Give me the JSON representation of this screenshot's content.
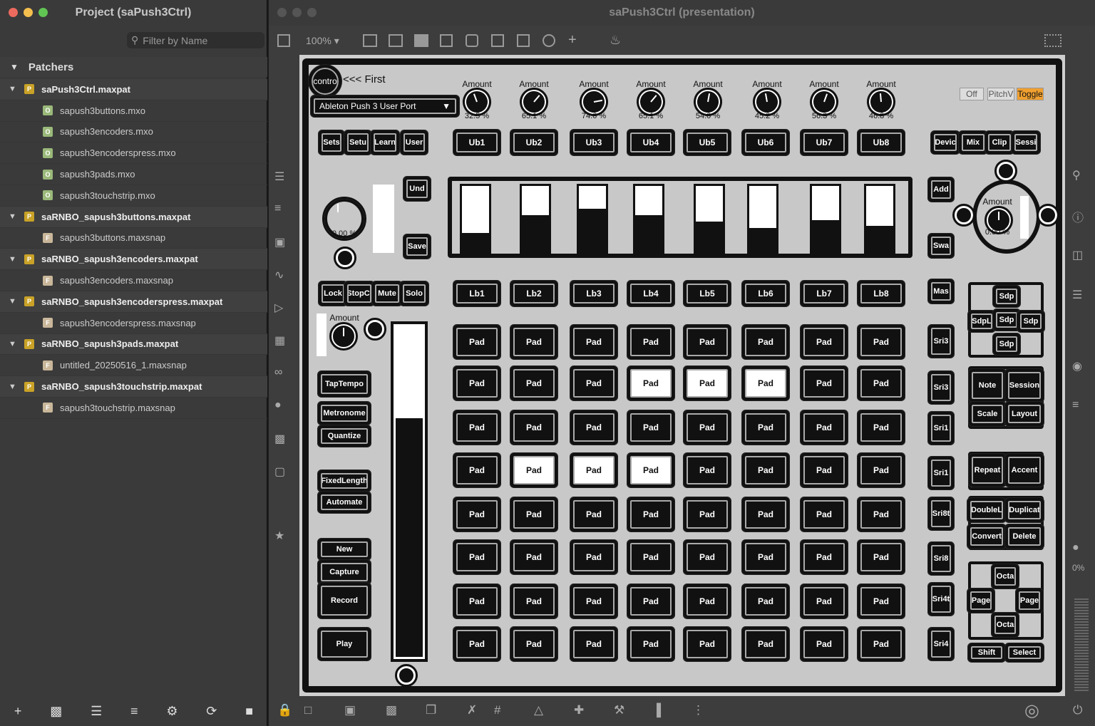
{
  "left": {
    "title": "Project (saPush3Ctrl)",
    "filter_placeholder": "Filter by Name",
    "section": "Patchers",
    "tree": [
      {
        "type": "project",
        "name": "saPush3Ctrl.maxpat",
        "badge": "P"
      },
      {
        "type": "child",
        "name": "sapush3buttons.mxo",
        "badge": "O"
      },
      {
        "type": "child",
        "name": "sapush3encoders.mxo",
        "badge": "O"
      },
      {
        "type": "child",
        "name": "sapush3encoderspress.mxo",
        "badge": "O"
      },
      {
        "type": "child",
        "name": "sapush3pads.mxo",
        "badge": "O"
      },
      {
        "type": "child",
        "name": "sapush3touchstrip.mxo",
        "badge": "O"
      },
      {
        "type": "project",
        "name": "saRNBO_sapush3buttons.maxpat",
        "badge": "P"
      },
      {
        "type": "child",
        "name": "sapush3buttons.maxsnap",
        "badge": "F"
      },
      {
        "type": "project",
        "name": "saRNBO_sapush3encoders.maxpat",
        "badge": "P"
      },
      {
        "type": "child",
        "name": "sapush3encoders.maxsnap",
        "badge": "F"
      },
      {
        "type": "project",
        "name": "saRNBO_sapush3encoderspress.maxpat",
        "badge": "P"
      },
      {
        "type": "child",
        "name": "sapush3encoderspress.maxsnap",
        "badge": "F"
      },
      {
        "type": "project",
        "name": "saRNBO_sapush3pads.maxpat",
        "badge": "P"
      },
      {
        "type": "child",
        "name": "untitled_20250516_1.maxsnap",
        "badge": "F"
      },
      {
        "type": "project",
        "name": "saRNBO_sapush3touchstrip.maxpat",
        "badge": "P"
      },
      {
        "type": "child",
        "name": "sapush3touchstrip.maxsnap",
        "badge": "F"
      }
    ],
    "bottom_icons": [
      "plus-icon",
      "comment-icon",
      "list-icon",
      "layers-icon",
      "gear-icon",
      "refresh-icon",
      "folder-icon"
    ]
  },
  "main": {
    "title": "saPush3Ctrl (presentation)",
    "zoom": "100%",
    "right_pct": "0%",
    "colors": {
      "accent": "#f0a030",
      "badge_p": "#c9a227",
      "badge_o": "#9ab97a",
      "badge_f": "#c9b79a"
    },
    "patch": {
      "contro": "contro",
      "first": "<<< First",
      "port": "Ableton Push 3 User Port",
      "knob_label": "Amount",
      "knobs": [
        "32.5 %",
        "65.1 %",
        "74.6 %",
        "65.1 %",
        "54.0 %",
        "45.2 %",
        "56.3 %",
        "46.8 %"
      ],
      "radio": [
        "Off",
        "PitchV",
        "Toggle"
      ],
      "top_left": [
        "Sets",
        "Setu",
        "Learn",
        "User"
      ],
      "upper_buttons": [
        "Ub1",
        "Ub2",
        "Ub3",
        "Ub4",
        "Ub5",
        "Ub6",
        "Ub7",
        "Ub8"
      ],
      "top_right": [
        "Devic",
        "Mix",
        "Clip",
        "Sessi"
      ],
      "undo": "Und",
      "save": "Save",
      "left_knob_val": "0.00 %",
      "right_knob_val": "0.00 %",
      "slider_levels": [
        0.33,
        0.6,
        0.7,
        0.6,
        0.5,
        0.4,
        0.52,
        0.44
      ],
      "vslider_left_level": 0.05,
      "tall_slider_level": 0.73,
      "lock_row": [
        "Lock",
        "StopCl",
        "Mute",
        "Solo"
      ],
      "lower_buttons": [
        "Lb1",
        "Lb2",
        "Lb3",
        "Lb4",
        "Lb5",
        "Lb6",
        "Lb7",
        "Lb8"
      ],
      "left_col": [
        "TapTempo",
        "Metronome",
        "Quantize",
        "FixedLength",
        "Automate",
        "New",
        "Capture",
        "Record",
        "Play"
      ],
      "pad_label": "Pad",
      "pads_on": [
        [
          1,
          3
        ],
        [
          1,
          4
        ],
        [
          1,
          5
        ],
        [
          3,
          1
        ],
        [
          3,
          2
        ],
        [
          3,
          3
        ]
      ],
      "add": "Add",
      "swa": "Swa",
      "mas": "Mas",
      "scene": [
        "Sri3",
        "Sri3",
        "Sri1",
        "Sri1",
        "Sri8t",
        "Sri8",
        "Sri4t",
        "Sri4"
      ],
      "dpad_top": [
        "Sdp",
        "SdpL",
        "Sdp",
        "Sdp",
        "Sdp"
      ],
      "mode": [
        "Note",
        "Session",
        "Scale",
        "Layout"
      ],
      "rep": [
        "Repeat",
        "Accent"
      ],
      "edit": [
        "DoubleL",
        "Duplicat",
        "Convert",
        "Delete"
      ],
      "nav": [
        "Octa",
        "Page",
        "Page",
        "Octa"
      ],
      "shift": "Shift",
      "select": "Select"
    }
  }
}
